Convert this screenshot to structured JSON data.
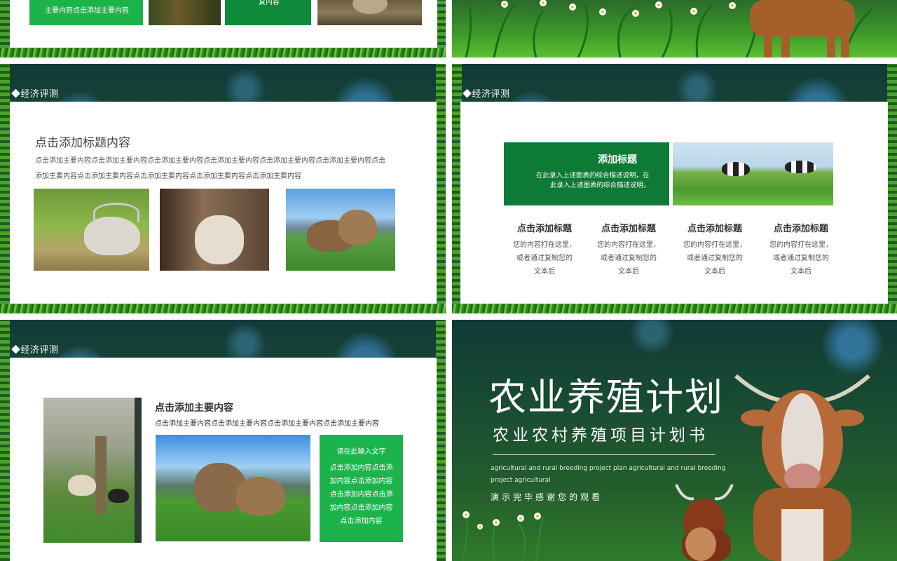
{
  "slide_top_left": {
    "green_box_text": "主要内容点击添加主要内容",
    "green_box2_text": "复内容"
  },
  "section_tag": "◆经济评测",
  "slide_mid_left": {
    "title": "点击添加标题内容",
    "body_line1": "点击添加主要内容点击添加主要内容点击添加主要内容点击添加主要内容点击添加主要内容点击添加主要内容点击",
    "body_line2": "添加主要内容点击添加主要内容点击添加主要内容点击添加主要内容点击添加主要内容"
  },
  "slide_mid_right": {
    "feature_title": "添加标题",
    "feature_desc_line1": "在此录入上述图表的综合描述说明，在",
    "feature_desc_line2": "此录入上述图表的综合描述说明，",
    "columns": [
      {
        "title": "点击添加标题",
        "l1": "您的内容打在这里，",
        "l2": "或者通过复制您的",
        "l3": "文本后"
      },
      {
        "title": "点击添加标题",
        "l1": "您的内容打在这里，",
        "l2": "或者通过复制您的",
        "l3": "文本后"
      },
      {
        "title": "点击添加标题",
        "l1": "您的内容打在这里，",
        "l2": "或者通过复制您的",
        "l3": "文本后"
      },
      {
        "title": "点击添加标题",
        "l1": "您的内容打在这里，",
        "l2": "或者通过复制您的",
        "l3": "文本后"
      }
    ]
  },
  "slide_bottom_left": {
    "title": "点击添加主要内容",
    "subtitle": "点击添加主要内容点击添加主要内容点击添加主要内容点击添加主要内容",
    "box_heading": "请在此输入文字",
    "box_lines": [
      "点击添加内容点击添",
      "加内容点击添加内容",
      "点击添加内容点击添",
      "加内容点击添加内容",
      "点击添加内容"
    ]
  },
  "slide_bottom_right": {
    "main_title": "农业养殖计划",
    "sub_title": "农业农村养殖项目计划书",
    "english_line1": "agricultural and rural breeding project plan agricultural and rural breeding",
    "english_line2": "project agricultural",
    "thanks": "演示完毕感谢您的观看"
  }
}
